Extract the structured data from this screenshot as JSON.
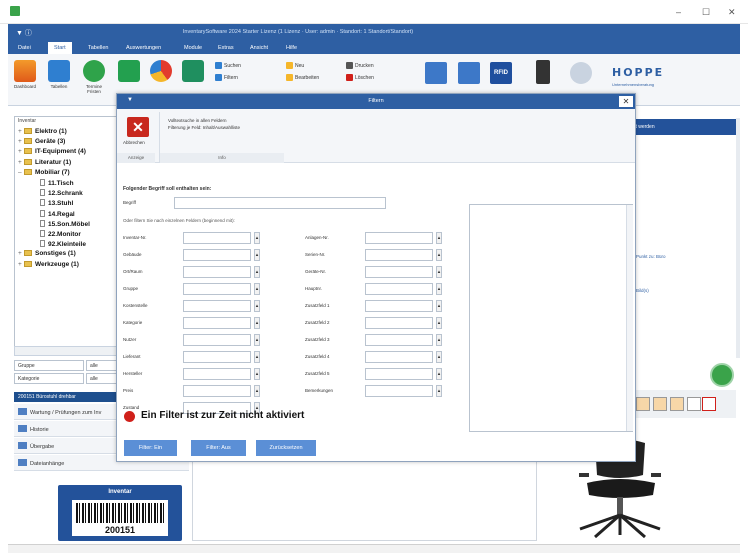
{
  "window": {
    "title_line": "InventarySoftware 2024 Starter Lizenz (1 Lizenz · User: admin · Standort: 1 Standort/Standort)",
    "min_glyph": "–",
    "max_glyph": "☐",
    "close_glyph": "✕"
  },
  "menu": [
    "Datei",
    "Start",
    "Tabellen",
    "Auswertungen",
    "Module",
    "Extras",
    "Ansicht",
    "Hilfe"
  ],
  "ribbon": {
    "big_buttons": [
      "Dashboard",
      "Tabellen",
      "Termine Fristen",
      "",
      "",
      ""
    ],
    "group_label": "Anzei",
    "small_buttons": [
      "Suchen",
      "Filtern",
      "Neu",
      "Bearbeiten",
      "Drucken",
      "Löschen"
    ],
    "rfid_label": "RFID",
    "hoppe_logo": "HOPPE",
    "hoppe_sub": "Unternehmensberatung"
  },
  "tree": {
    "header": "Inventar",
    "nodes": [
      {
        "ex": "+",
        "type": "folder",
        "label": "Elektro  (1)",
        "level": 0
      },
      {
        "ex": "+",
        "type": "folder",
        "label": "Geräte  (3)",
        "level": 0
      },
      {
        "ex": "+",
        "type": "folder",
        "label": "IT-Equipment  (4)",
        "level": 0
      },
      {
        "ex": "+",
        "type": "folder",
        "label": "Literatur  (1)",
        "level": 0
      },
      {
        "ex": "–",
        "type": "folder",
        "label": "Mobiliar  (7)",
        "level": 0
      },
      {
        "ex": "",
        "type": "doc",
        "label": "11.Tisch",
        "level": 1
      },
      {
        "ex": "",
        "type": "doc",
        "label": "12.Schrank",
        "level": 1
      },
      {
        "ex": "",
        "type": "doc",
        "label": "13.Stuhl",
        "level": 1
      },
      {
        "ex": "",
        "type": "doc",
        "label": "14.Regal",
        "level": 1
      },
      {
        "ex": "",
        "type": "doc",
        "label": "15.Son.Möbel",
        "level": 1
      },
      {
        "ex": "",
        "type": "doc",
        "label": "22.Monitor",
        "level": 1
      },
      {
        "ex": "",
        "type": "doc",
        "label": "92.Kleinteile",
        "level": 1
      },
      {
        "ex": "+",
        "type": "folder",
        "label": "Sonstiges  (1)",
        "level": 0
      },
      {
        "ex": "+",
        "type": "folder",
        "label": "Werkzeuge  (1)",
        "level": 0
      }
    ]
  },
  "left_filters": [
    {
      "label": "Gruppe",
      "value": "alle"
    },
    {
      "label": "Kategorie",
      "value": "alle"
    }
  ],
  "left_nav": {
    "header": "200151 Bürostuhl drehbar",
    "items": [
      "Wartung / Prüfungen zum Inventar",
      "Historie",
      "Dateianhänge"
    ],
    "items_extra": "Dateianhänge"
  },
  "nav_items": [
    "Wartung / Prüfungen zum Inv",
    "Historie",
    "Übergabe",
    "Dateianhänge"
  ],
  "inventory_card": {
    "title": "Inventar",
    "number": "200151"
  },
  "right_panel": {
    "header": "Alt werden",
    "texts": [
      "Punkt zu: Büro",
      "Bild(s)"
    ]
  },
  "dialog": {
    "title": "Filtern",
    "close_glyph": "✕",
    "abbrechen": "Abbrechen",
    "group1_label": "Anzeige",
    "group2_label": "Info",
    "info_lines": [
      "Volltextsuche in allen Feldern",
      "Filterung je Feld: Inhalt/Auswahlliste"
    ],
    "heading": "Folgender Begriff soll enthalten sein:",
    "begriff_label": "Begriff",
    "begriff_value": "",
    "subheading": "Oder filtern Sie nach einzelnen Feldern (beginnend mit):",
    "left_fields": [
      "Inventar-Nr.",
      "Gebäude",
      "Ort/Raum",
      "Gruppe",
      "Kostenstelle",
      "Kategorie",
      "Nutzer",
      "Lieferant",
      "Hersteller",
      "Preis",
      "Zustand"
    ],
    "right_fields": [
      "Anlagen-Nr.",
      "Serien-Nr.",
      "Geräte-Nr.",
      "Hauptnr.",
      "Zusatzfeld 1",
      "Zusatzfeld 2",
      "Zusatzfeld 3",
      "Zusatzfeld 4",
      "Zusatzfeld 5",
      "Bemerkungen"
    ],
    "status_text": "Ein Filter ist zur Zeit nicht aktiviert",
    "buttons": [
      "Filter: Ein",
      "Filter: Aus",
      "Zurücksetzen"
    ]
  },
  "colors": {
    "accent": "#2e5fa3",
    "status_red": "#d0201a",
    "close_red": "#c8281e"
  }
}
